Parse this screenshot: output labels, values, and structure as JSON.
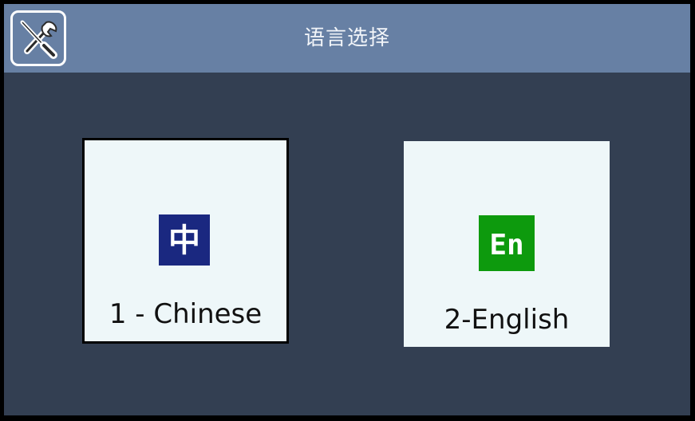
{
  "header": {
    "title": "语言选择",
    "settings_icon": "tools-icon"
  },
  "languages": [
    {
      "label": "1 - Chinese",
      "icon_glyph": "中",
      "icon_color": "#1a2880"
    },
    {
      "label": "2-English",
      "icon_glyph": "En",
      "icon_color": "#0d9a0d"
    }
  ],
  "colors": {
    "titlebar": "#6780a4",
    "background": "#333f52",
    "tile": "#eef7f9"
  }
}
